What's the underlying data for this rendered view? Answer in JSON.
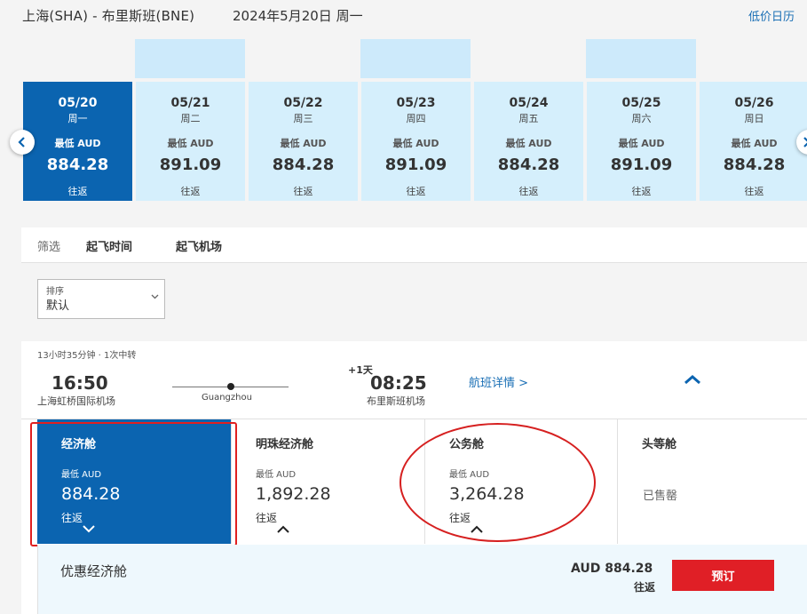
{
  "header": {
    "route": "上海(SHA) - 布里斯班(BNE)",
    "date": "2024年5月20日 周一",
    "calendar_link": "低价日历"
  },
  "accent_color": "#0b64b0",
  "light_color": "#d5effc",
  "book_color": "#e01f26",
  "days": [
    {
      "date": "05/20",
      "weekday": "周一",
      "label": "最低 AUD",
      "price": "884.28",
      "trip": "往返",
      "selected": true
    },
    {
      "date": "05/21",
      "weekday": "周二",
      "label": "最低 AUD",
      "price": "891.09",
      "trip": "往返"
    },
    {
      "date": "05/22",
      "weekday": "周三",
      "label": "最低 AUD",
      "price": "884.28",
      "trip": "往返"
    },
    {
      "date": "05/23",
      "weekday": "周四",
      "label": "最低 AUD",
      "price": "891.09",
      "trip": "往返"
    },
    {
      "date": "05/24",
      "weekday": "周五",
      "label": "最低 AUD",
      "price": "884.28",
      "trip": "往返"
    },
    {
      "date": "05/25",
      "weekday": "周六",
      "label": "最低 AUD",
      "price": "891.09",
      "trip": "往返"
    },
    {
      "date": "05/26",
      "weekday": "周日",
      "label": "最低 AUD",
      "price": "884.28",
      "trip": "往返"
    }
  ],
  "filter": {
    "label": "筛选",
    "departure_time": "起飞时间",
    "departure_airport": "起飞机场"
  },
  "sort": {
    "label": "排序",
    "value": "默认"
  },
  "flight": {
    "meta": "13小时35分钟 · 1次中转",
    "depart_time": "16:50",
    "depart_airport": "上海虹桥国际机场",
    "via": "Guangzhou",
    "day_offset": "+1天",
    "arrive_time": "08:25",
    "arrive_airport": "布里斯班机场",
    "details_link": "航班详情 >"
  },
  "cabins": [
    {
      "name": "经济舱",
      "label": "最低 AUD",
      "price": "884.28",
      "trip": "往返",
      "selected": true
    },
    {
      "name": "明珠经济舱",
      "label": "最低 AUD",
      "price": "1,892.28",
      "trip": "往返"
    },
    {
      "name": "公务舱",
      "label": "最低 AUD",
      "price": "3,264.28",
      "trip": "往返"
    },
    {
      "name": "头等舱",
      "sold_out": "已售罄"
    }
  ],
  "fare": {
    "name": "优惠经济舱",
    "price": "AUD 884.28",
    "trip": "往返",
    "book": "预订"
  },
  "icons": [
    "chevron-left-icon",
    "chevron-right-icon",
    "chevron-down-icon",
    "chevron-up-icon"
  ]
}
